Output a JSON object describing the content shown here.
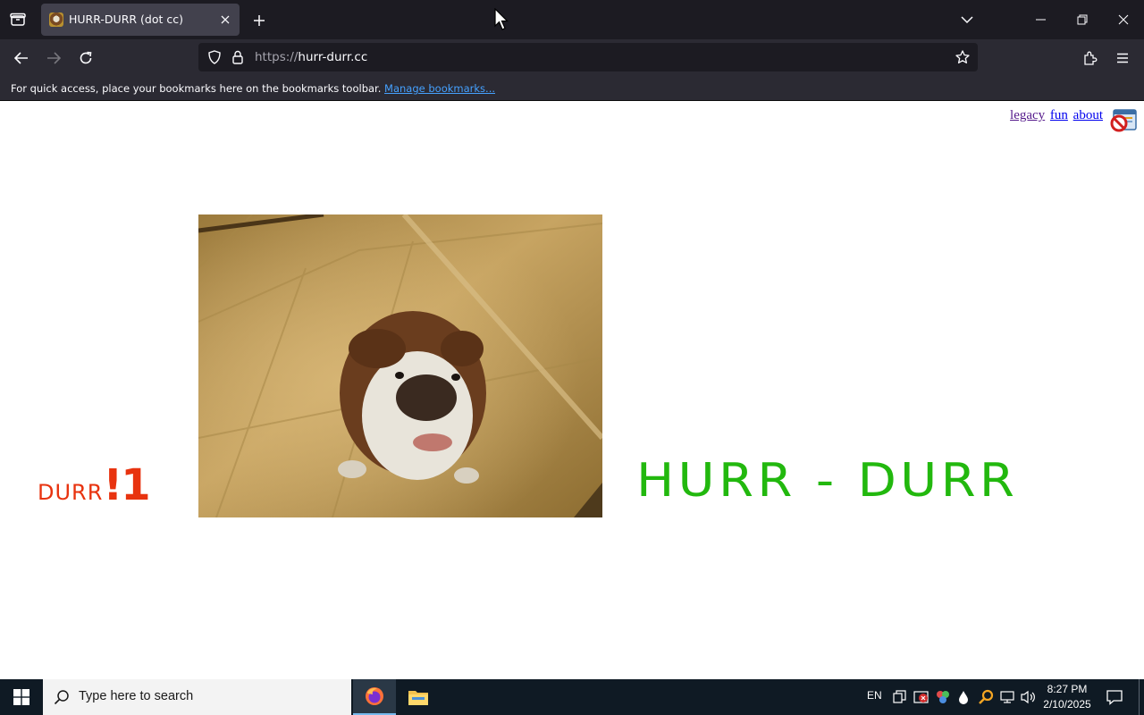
{
  "browser": {
    "tab": {
      "title": "HURR-DURR (dot cc)"
    },
    "url": {
      "scheme": "https://",
      "host": "hurr-durr.cc"
    },
    "bookmarks_bar": {
      "message": "For quick access, place your bookmarks here on the bookmarks toolbar.",
      "manage_link": "Manage bookmarks..."
    }
  },
  "page": {
    "nav": {
      "legacy": "legacy",
      "fun": "fun",
      "about": "about"
    },
    "durr": {
      "small": "DURR",
      "big": "!1"
    },
    "hurr": "HURR - DURR",
    "colors": {
      "durr": "#e8330f",
      "hurr": "#22b80e"
    }
  },
  "taskbar": {
    "search_placeholder": "Type here to search",
    "language": "EN",
    "time": "8:27 PM",
    "date": "2/10/2025"
  }
}
